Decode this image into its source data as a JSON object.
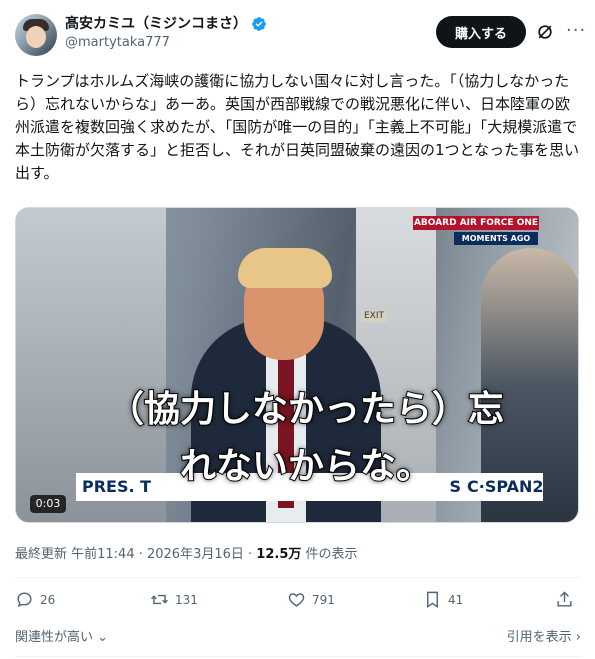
{
  "author": {
    "display_name": "髙安カミユ（ミジンコまさ）",
    "handle": "@martytaka777"
  },
  "header": {
    "subscribe_label": "購入する",
    "grok_icon": "grok-icon",
    "more_icon": "more-icon"
  },
  "tweet": {
    "text": "トランプはホルムズ海峡の護衛に協力しない国々に対し言った。「（協力しなかったら）忘れないからな」あーあ。英国が西部戦線での戦況悪化に伴い、日本陸軍の欧州派遣を複数回強く求めたが、「国防が唯一の目的」「主義上不可能」「大規模派遣で本土防衛が欠落する」と拒否し、それが日英同盟破棄の遠因の1つとなった事を思い出す。"
  },
  "media": {
    "tag_primary": "ABOARD AIR FORCE ONE",
    "tag_secondary": "MOMENTS AGO",
    "lower_third": "PRES. T",
    "lower_third_suffix": "S",
    "network": "C·SPAN2",
    "subtitle_line1": "（協力しなかったら）忘",
    "subtitle_line2": "れないからな。",
    "exit_sign": "EXIT",
    "duration": "0:03"
  },
  "meta": {
    "updated_label": "最終更新 午前11:44 · 2026年3月16日 · ",
    "views_count": "12.5万",
    "views_label": " 件の表示"
  },
  "actions": {
    "replies": "26",
    "reposts": "131",
    "likes": "791",
    "bookmarks": "41"
  },
  "footer": {
    "sort_label": "関連性が高い",
    "quotes_label": "引用を表示"
  },
  "colors": {
    "verified": "#1d9bf0",
    "muted": "#536471",
    "text": "#0f1419"
  }
}
